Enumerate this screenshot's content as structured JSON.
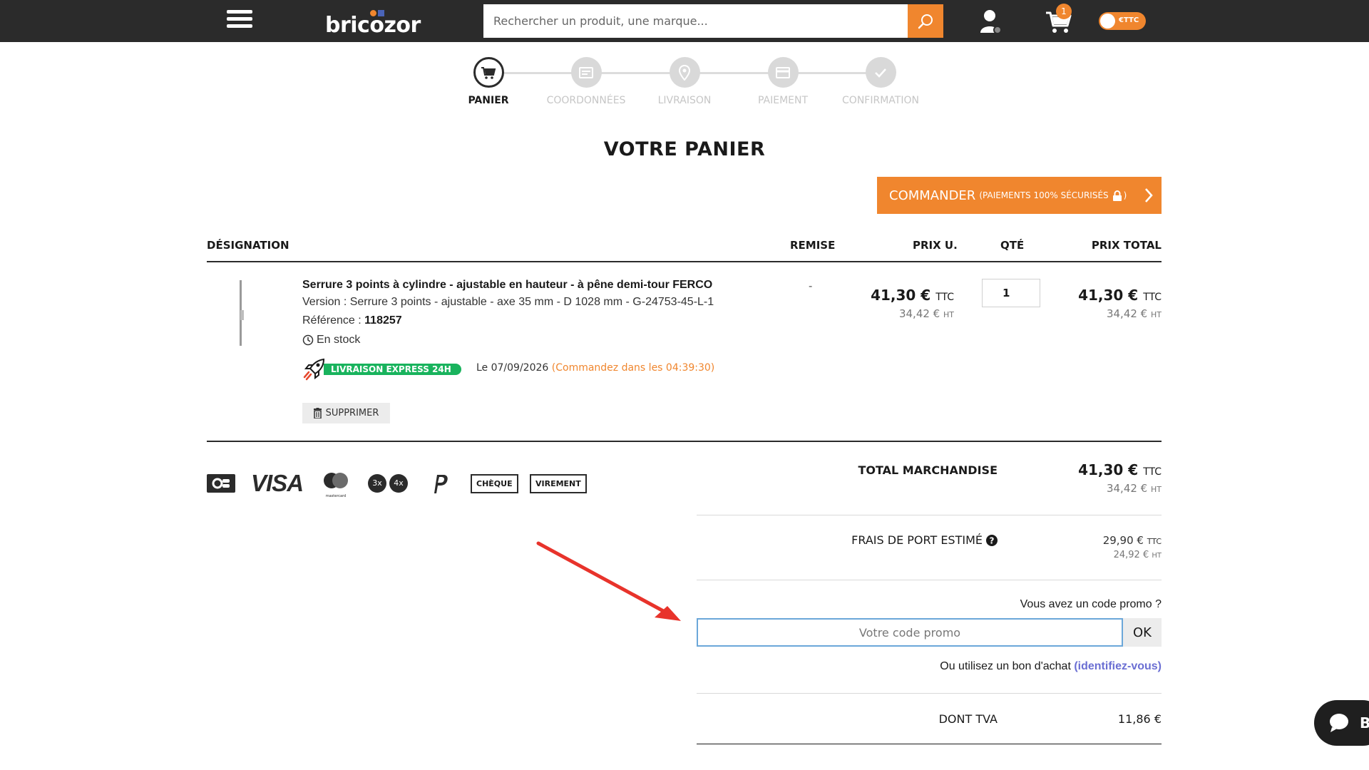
{
  "header": {
    "logo_text": "bricozor",
    "search_placeholder": "Rechercher un produit, une marque...",
    "cart_count": "1",
    "price_toggle": "€TTC",
    "colors": {
      "bar": "#2b2b2b",
      "accent": "#f0862e"
    }
  },
  "stepper": {
    "steps": [
      {
        "label": "PANIER",
        "icon": "cart-icon",
        "active": true
      },
      {
        "label": "COORDONNÉES",
        "icon": "id-card-icon",
        "active": false
      },
      {
        "label": "LIVRAISON",
        "icon": "map-pin-icon",
        "active": false
      },
      {
        "label": "PAIEMENT",
        "icon": "credit-card-icon",
        "active": false
      },
      {
        "label": "CONFIRMATION",
        "icon": "check-icon",
        "active": false
      }
    ]
  },
  "page": {
    "title": "VOTRE PANIER",
    "command_main": "COMMANDER",
    "command_sub": "(PAIEMENTS 100% SÉCURISÉS",
    "command_sub_end": ")"
  },
  "table": {
    "headers": {
      "designation": "DÉSIGNATION",
      "remise": "REMISE",
      "prix_u": "PRIX U.",
      "qte": "QTÉ",
      "prix_total": "PRIX TOTAL"
    },
    "item": {
      "name": "Serrure 3 points à cylindre - ajustable en hauteur - à pêne demi-tour FERCO",
      "version": "Version : Serrure 3 points - ajustable - axe 35 mm - D 1028 mm - G-24753-45-L-1",
      "ref_label": "Référence : ",
      "ref_value": "118257",
      "stock": "En stock",
      "express": "LIVRAISON EXPRESS 24H",
      "delivery_date": "Le 07/09/2026 ",
      "countdown": "(Commandez dans les 04:39:30)",
      "delete": "SUPPRIMER",
      "remise": "-",
      "unit_ttc": "41,30 € ",
      "unit_ttc_suffix": "TTC",
      "unit_ht": "34,42 € ",
      "unit_ht_suffix": "HT",
      "quantity": "1",
      "total_ttc": "41,30 € ",
      "total_ttc_suffix": "TTC",
      "total_ht": "34,42 € ",
      "total_ht_suffix": "HT"
    }
  },
  "payments": {
    "methods": [
      "cb-card-icon",
      "visa-icon",
      "mastercard-icon",
      "3x-4x-icon",
      "paypal-icon"
    ],
    "visa": "VISA",
    "mastercard_caption": "mastercard",
    "p3x": "3x",
    "p4x": "4x",
    "cheque": "CHÈQUE",
    "virement": "VIREMENT"
  },
  "totals": {
    "merch_label": "TOTAL MARCHANDISE",
    "merch_ttc": "41,30 € ",
    "merch_ttc_suffix": "TTC",
    "merch_ht": "34,42 € ",
    "merch_ht_suffix": "HT",
    "shipping_label": "FRAIS DE PORT ESTIMÉ",
    "shipping_ttc": "29,90 € ",
    "shipping_ttc_suffix": "TTC",
    "shipping_ht": "24,92 € ",
    "shipping_ht_suffix": "HT",
    "promo_question": "Vous avez un code promo ?",
    "promo_placeholder": "Votre code promo",
    "promo_ok": "OK",
    "voucher_text": "Ou utilisez un bon d'achat ",
    "voucher_link": "(identifiez-vous)",
    "tva_label": "DONT TVA",
    "tva_value": "11,86 €"
  },
  "chat": {
    "label": "B"
  }
}
